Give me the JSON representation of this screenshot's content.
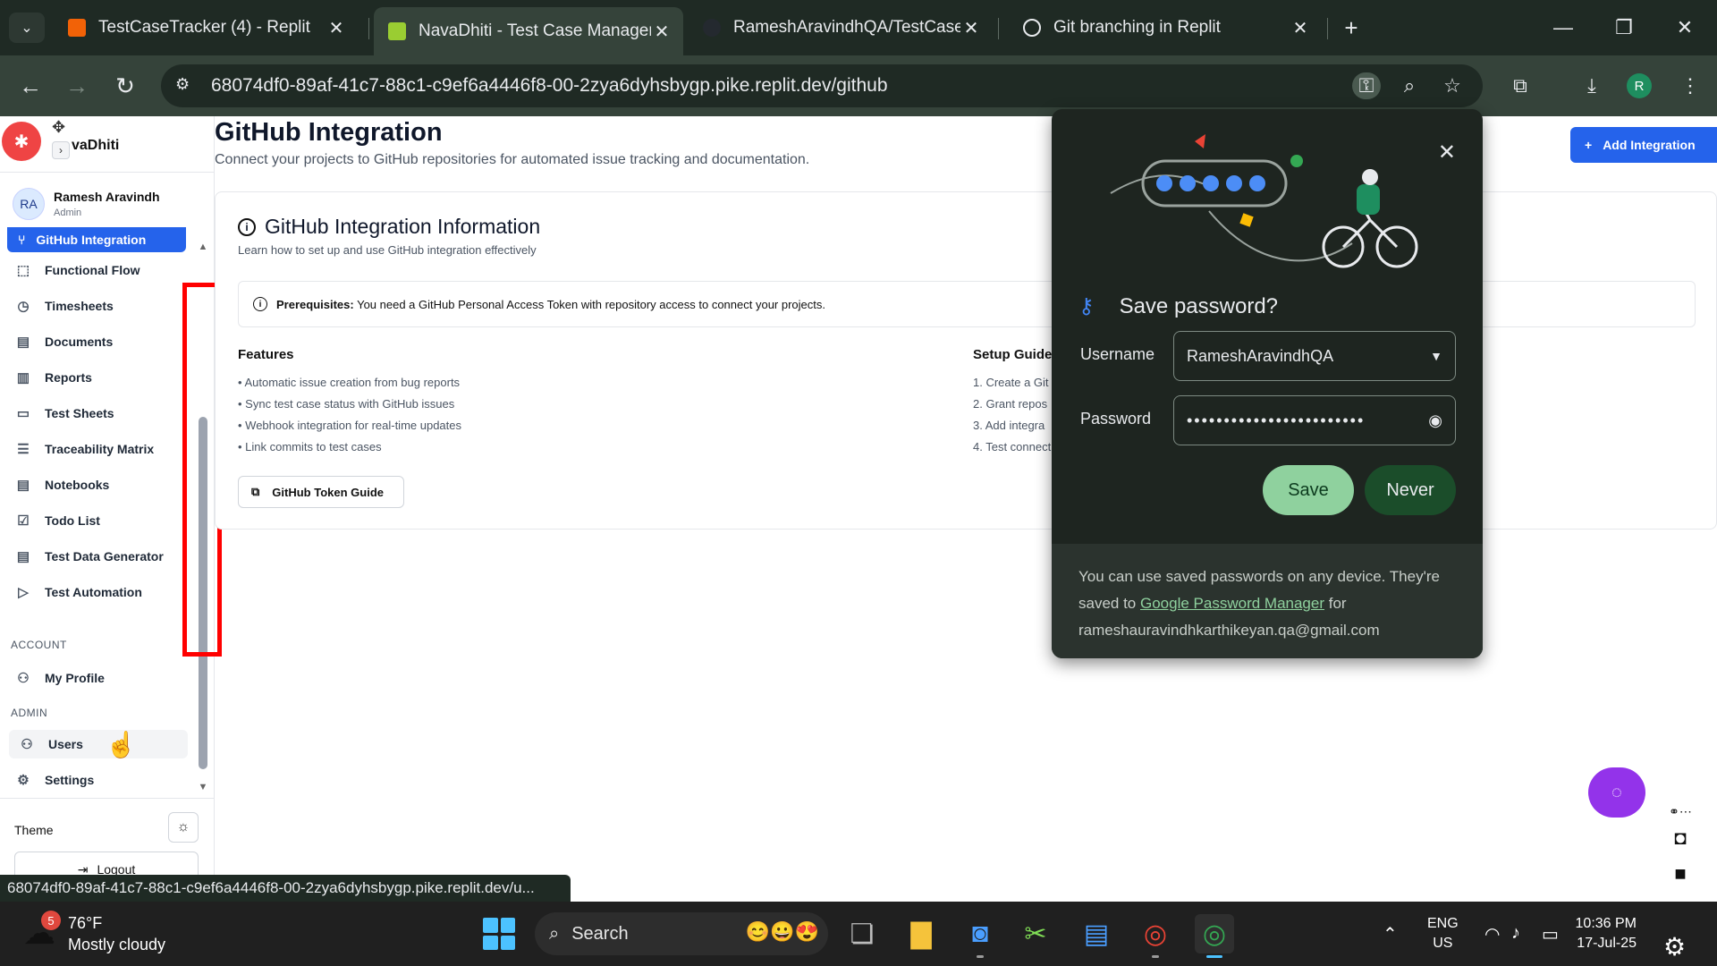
{
  "browser": {
    "tabs": [
      {
        "title": "TestCaseTracker (4) - Replit",
        "favicon_color": "#f26207",
        "active": false
      },
      {
        "title": "NavaDhiti - Test Case Managem",
        "favicon_color": "#9acd32",
        "active": true
      },
      {
        "title": "RameshAravindhQA/TestCaseTr",
        "favicon_color": "#24292f",
        "active": false
      },
      {
        "title": "Git branching in Replit",
        "favicon_color": "#e8eaed",
        "active": false
      }
    ],
    "url": "68074df0-89af-41c7-88c1-c9ef6a4446f8-00-2zya6dyhsbygp.pike.replit.dev/github",
    "profile_initial": "R",
    "status_url": "68074df0-89af-41c7-88c1-c9ef6a4446f8-00-2zya6dyhsbygp.pike.replit.dev/u..."
  },
  "sidebar": {
    "brand": "vaDhiti",
    "user": {
      "initials": "RA",
      "name": "Ramesh Aravindh",
      "role": "Admin"
    },
    "active_item": "GitHub Integration",
    "items": [
      {
        "label": "Functional Flow",
        "icon": "dashed-square-icon"
      },
      {
        "label": "Timesheets",
        "icon": "clock-icon"
      },
      {
        "label": "Documents",
        "icon": "document-icon"
      },
      {
        "label": "Reports",
        "icon": "report-icon"
      },
      {
        "label": "Test Sheets",
        "icon": "sheet-icon"
      },
      {
        "label": "Traceability Matrix",
        "icon": "filter-lines-icon"
      },
      {
        "label": "Notebooks",
        "icon": "notebook-icon"
      },
      {
        "label": "Todo List",
        "icon": "checkbox-icon"
      },
      {
        "label": "Test Data Generator",
        "icon": "file-text-icon"
      },
      {
        "label": "Test Automation",
        "icon": "play-icon"
      }
    ],
    "account_label": "ACCOUNT",
    "profile_item": "My Profile",
    "admin_label": "ADMIN",
    "users_item": "Users",
    "settings_item": "Settings",
    "theme_label": "Theme",
    "logout_label": "Logout"
  },
  "main": {
    "title": "GitHub Integration",
    "subtitle": "Connect your projects to GitHub repositories for automated issue tracking and documentation.",
    "add_button": "Add Integration",
    "card": {
      "title": "GitHub Integration Information",
      "subtitle": "Learn how to set up and use GitHub integration effectively",
      "prereq_bold": "Prerequisites:",
      "prereq_text": "You need a GitHub Personal Access Token with repository access to connect your projects.",
      "features_heading": "Features",
      "features": [
        "• Automatic issue creation from bug reports",
        "• Sync test case status with GitHub issues",
        "• Webhook integration for real-time updates",
        "• Link commits to test cases"
      ],
      "setup_heading": "Setup Guide",
      "setup": [
        "1. Create a Git",
        "2. Grant repos",
        "3. Add integra",
        "4. Test connect"
      ],
      "token_button": "GitHub Token Guide"
    }
  },
  "password_popup": {
    "title": "Save password?",
    "username_label": "Username",
    "username_value": "RameshAravindhQA",
    "password_label": "Password",
    "password_value": "••••••••••••••••••••••••",
    "save_label": "Save",
    "never_label": "Never",
    "footer_before": "You can use saved passwords on any device. They're saved to",
    "footer_link": "Google Password Manager",
    "footer_after": "for",
    "footer_email": "rameshauravindhkarthikeyan.qa@gmail.com"
  },
  "taskbar": {
    "weather_badge": "5",
    "temp": "76°F",
    "condition": "Mostly cloudy",
    "search_placeholder": "Search",
    "lang_top": "ENG",
    "lang_bottom": "US",
    "time": "10:36 PM",
    "date": "17-Jul-25"
  },
  "colors": {
    "accent": "#2563eb",
    "chrome_dark": "#1f2a24",
    "popup_bg": "#1e2520",
    "save_green": "#8fd19e",
    "never_green": "#1b4d2a",
    "highlight_red": "#ff0000",
    "chat_purple": "#9333ea"
  }
}
